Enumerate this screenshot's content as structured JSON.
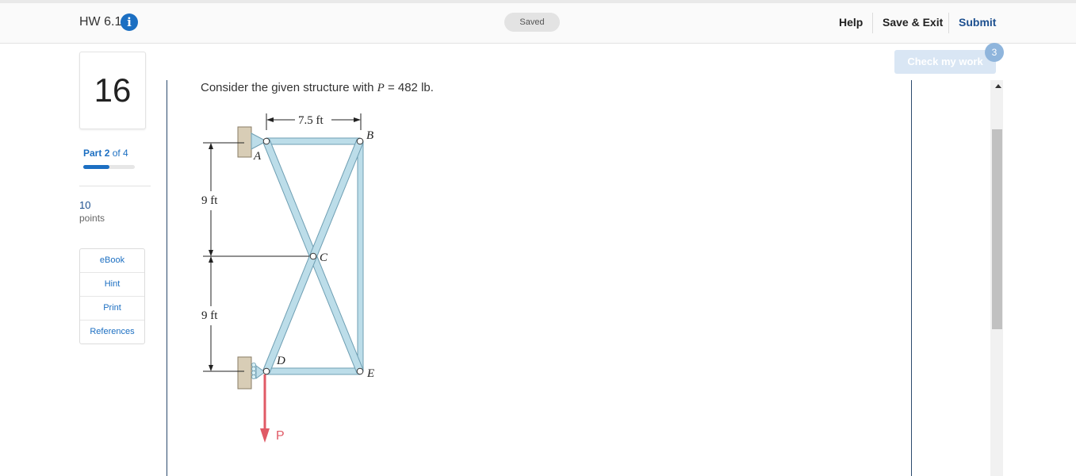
{
  "header": {
    "assignment_title": "HW 6.1",
    "info_icon": "info-icon",
    "status": "Saved",
    "help_label": "Help",
    "save_exit_label": "Save & Exit",
    "submit_label": "Submit"
  },
  "sidebar": {
    "question_number": "16",
    "part_word": "Part",
    "part_current": "2",
    "part_total_text": "of 4",
    "part_progress_fraction": 0.5,
    "points_value": "10",
    "points_label": "points",
    "buttons": [
      "eBook",
      "Hint",
      "Print",
      "References"
    ]
  },
  "check_work": {
    "label": "Check my work",
    "badge": "3"
  },
  "question": {
    "text_before": "Consider the given structure with ",
    "variable": "P",
    "text_after": " = 482 lb."
  },
  "figure": {
    "dim_top": "7.5 ft",
    "dim_upper": "9 ft",
    "dim_lower": "9 ft",
    "label_A": "A",
    "label_B": "B",
    "label_C": "C",
    "label_D": "D",
    "label_E": "E",
    "label_P": "P",
    "member_color": "#bcdde9",
    "member_edge_color": "#6f9fb3",
    "load_color": "#e05a66"
  }
}
